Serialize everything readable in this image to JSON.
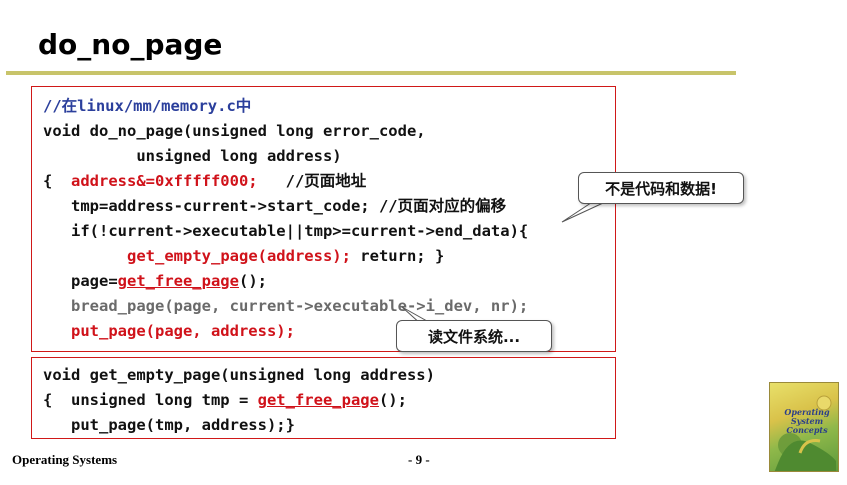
{
  "slide": {
    "title": "do_no_page"
  },
  "code_box_1": {
    "lines": [
      {
        "seg": [
          {
            "t": "//在linux/mm/memory.c中",
            "c": "c-blue"
          }
        ]
      },
      {
        "seg": [
          {
            "t": "void do_no_page(unsigned long error_code,",
            "c": ""
          }
        ]
      },
      {
        "seg": [
          {
            "t": "          unsigned long address)",
            "c": ""
          }
        ]
      },
      {
        "seg": [
          {
            "t": "{  ",
            "c": ""
          },
          {
            "t": "address&=0xfffff000;",
            "c": "c-red"
          },
          {
            "t": "   //页面地址",
            "c": ""
          }
        ]
      },
      {
        "seg": [
          {
            "t": "   tmp=address-current->start_code; //页面对应的偏移",
            "c": ""
          }
        ]
      },
      {
        "seg": [
          {
            "t": "   if(!current->executable||tmp>=current->end_data){",
            "c": ""
          }
        ]
      },
      {
        "seg": [
          {
            "t": "         ",
            "c": ""
          },
          {
            "t": "get_empty_page(address);",
            "c": "c-red"
          },
          {
            "t": " return; }",
            "c": ""
          }
        ]
      },
      {
        "seg": [
          {
            "t": "   page=",
            "c": ""
          },
          {
            "t": "get_free_page",
            "c": "c-ul"
          },
          {
            "t": "();",
            "c": ""
          }
        ]
      },
      {
        "seg": [
          {
            "t": "   bread_page(page, current->executable->i_dev, nr);",
            "c": "c-gray"
          }
        ]
      },
      {
        "seg": [
          {
            "t": "   put_page(page, address);",
            "c": "c-red"
          }
        ]
      }
    ]
  },
  "code_box_2": {
    "lines": [
      {
        "seg": [
          {
            "t": "void get_empty_page(unsigned long address)",
            "c": ""
          }
        ]
      },
      {
        "seg": [
          {
            "t": "{  unsigned long tmp = ",
            "c": ""
          },
          {
            "t": "get_free_page",
            "c": "c-ul"
          },
          {
            "t": "();",
            "c": ""
          }
        ]
      },
      {
        "seg": [
          {
            "t": "   put_page(tmp, address);}",
            "c": ""
          }
        ]
      }
    ]
  },
  "callouts": {
    "not_code_data": "不是代码和数据!",
    "read_fs": "读文件系统..."
  },
  "footer": {
    "course": "Operating Systems",
    "page": "- 9 -"
  },
  "book_cover": {
    "title": "Operating System Concepts"
  },
  "colors": {
    "accent_rule": "#c8c46a",
    "box_border": "#d01818",
    "comment_blue": "#2b3f9c",
    "highlight_red": "#d0121a",
    "muted_gray": "#6a6a6a"
  }
}
